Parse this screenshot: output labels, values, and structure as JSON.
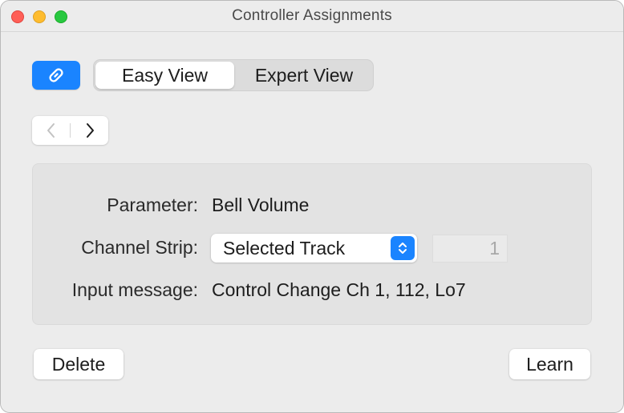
{
  "window": {
    "title": "Controller Assignments"
  },
  "toolbar": {
    "link_icon": "link-icon",
    "tabs": [
      {
        "label": "Easy View",
        "selected": true
      },
      {
        "label": "Expert View",
        "selected": false
      }
    ]
  },
  "navigation": {
    "prev_icon": "chevron-left-icon",
    "next_icon": "chevron-right-icon"
  },
  "panel": {
    "parameter_label": "Parameter:",
    "parameter_value": "Bell Volume",
    "channel_strip_label": "Channel Strip:",
    "channel_strip_value": "Selected Track",
    "channel_strip_number": "1",
    "input_message_label": "Input message:",
    "input_message_value": "Control Change Ch 1, 112, Lo7"
  },
  "buttons": {
    "delete_label": "Delete",
    "learn_label": "Learn"
  },
  "colors": {
    "accent": "#1a84ff",
    "close": "#ff5f57",
    "minimize": "#febc2e",
    "maximize": "#28c840"
  }
}
